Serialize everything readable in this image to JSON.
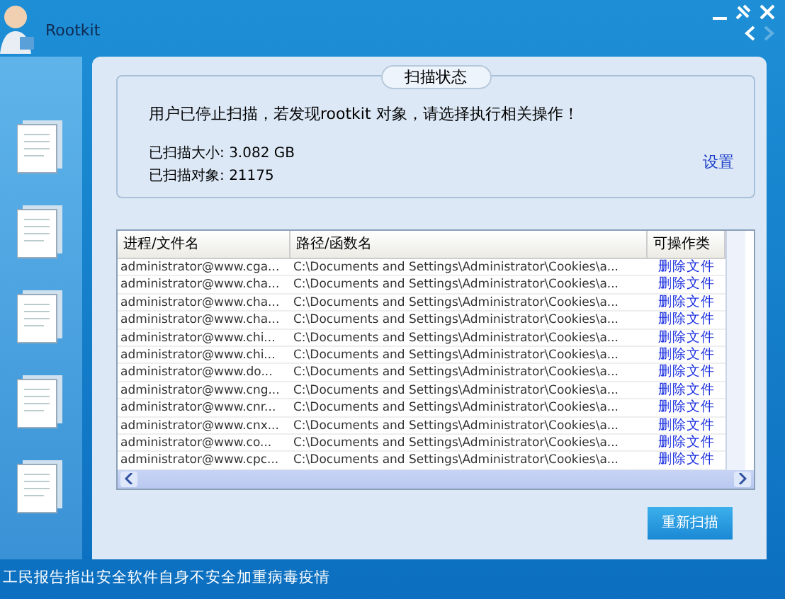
{
  "window": {
    "title": "Rootkit"
  },
  "scan_status": {
    "title": "扫描状态",
    "message": "用户已停止扫描，若发现rootkit 对象，请选择执行相关操作！",
    "size_label": "已扫描大小:",
    "size_value": "3.082 GB",
    "count_label": "已扫描对象:",
    "count_value": "21175",
    "settings_link": "设置"
  },
  "table": {
    "columns": [
      "进程/文件名",
      "路径/函数名",
      "可操作类"
    ],
    "rows": [
      {
        "file": "administrator@www.cga...",
        "path": "C:\\Documents and Settings\\Administrator\\Cookies\\a...",
        "action": "删除文件"
      },
      {
        "file": "administrator@www.cha...",
        "path": "C:\\Documents and Settings\\Administrator\\Cookies\\a...",
        "action": "删除文件"
      },
      {
        "file": "administrator@www.cha...",
        "path": "C:\\Documents and Settings\\Administrator\\Cookies\\a...",
        "action": "删除文件"
      },
      {
        "file": "administrator@www.cha...",
        "path": "C:\\Documents and Settings\\Administrator\\Cookies\\a...",
        "action": "删除文件"
      },
      {
        "file": "administrator@www.chi...",
        "path": "C:\\Documents and Settings\\Administrator\\Cookies\\a...",
        "action": "删除文件"
      },
      {
        "file": "administrator@www.chi...",
        "path": "C:\\Documents and Settings\\Administrator\\Cookies\\a...",
        "action": "删除文件"
      },
      {
        "file": "administrator@www.do...",
        "path": "C:\\Documents and Settings\\Administrator\\Cookies\\a...",
        "action": "删除文件"
      },
      {
        "file": "administrator@www.cng...",
        "path": "C:\\Documents and Settings\\Administrator\\Cookies\\a...",
        "action": "删除文件"
      },
      {
        "file": "administrator@www.cnr...",
        "path": "C:\\Documents and Settings\\Administrator\\Cookies\\a...",
        "action": "删除文件"
      },
      {
        "file": "administrator@www.cnx...",
        "path": "C:\\Documents and Settings\\Administrator\\Cookies\\a...",
        "action": "删除文件"
      },
      {
        "file": "administrator@www.co...",
        "path": "C:\\Documents and Settings\\Administrator\\Cookies\\a...",
        "action": "删除文件"
      },
      {
        "file": "administrator@www.cpc...",
        "path": "C:\\Documents and Settings\\Administrator\\Cookies\\a...",
        "action": "删除文件"
      }
    ]
  },
  "rescan_button": "重新扫描",
  "status_bar": {
    "news": "工民报告指出安全软件自身不安全加重病毒疫情"
  }
}
